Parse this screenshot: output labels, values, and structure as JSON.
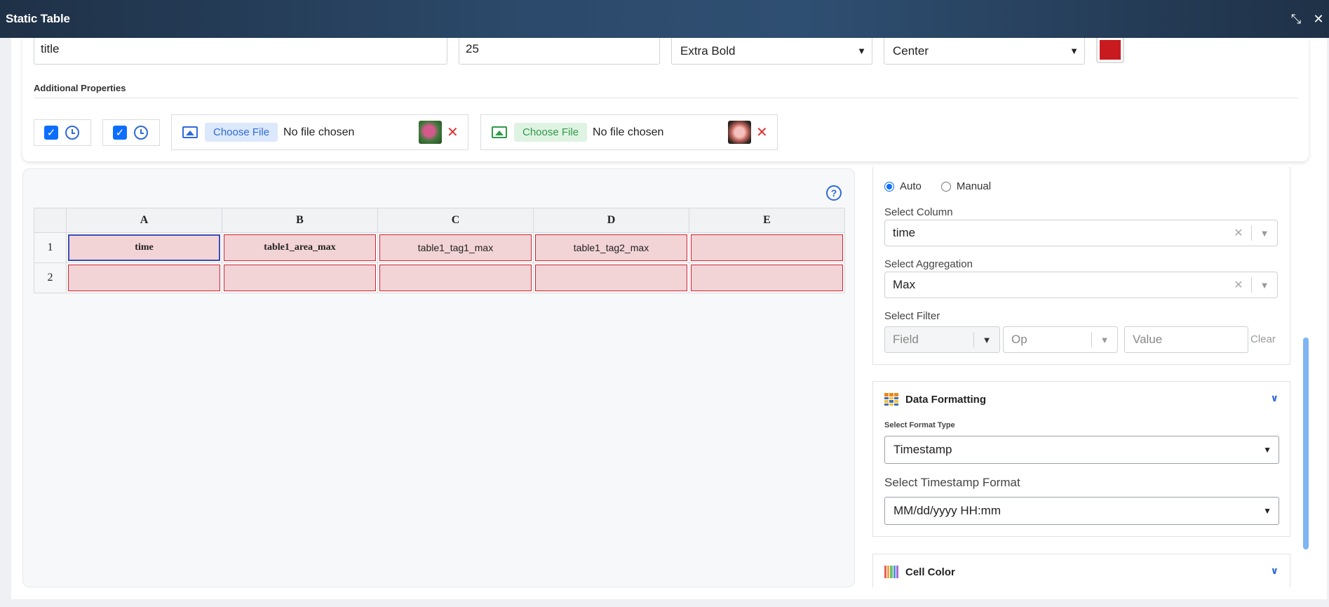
{
  "window": {
    "title": "Static Table",
    "restore_icon": "compress-icon",
    "close_icon": "close-icon"
  },
  "title_props": {
    "text_value": "title",
    "font_size": "25",
    "font_weight": "Extra Bold",
    "alignment": "Center",
    "color": "#c91a1f"
  },
  "additional": {
    "label": "Additional Properties",
    "file1": {
      "button": "Choose File",
      "status": "No file chosen",
      "accent": "#2f6ad9"
    },
    "file2": {
      "button": "Choose File",
      "status": "No file chosen",
      "accent": "#2f9a48"
    },
    "remove": "✕"
  },
  "grid": {
    "help": "?",
    "columns": [
      "A",
      "B",
      "C",
      "D",
      "E"
    ],
    "rows": [
      {
        "num": "1",
        "cells": [
          "time",
          "table1_area_max",
          "table1_tag1_max",
          "table1_tag2_max",
          ""
        ]
      },
      {
        "num": "2",
        "cells": [
          "",
          "",
          "",
          "",
          ""
        ]
      }
    ]
  },
  "config": {
    "mode_auto": "Auto",
    "mode_manual": "Manual",
    "column_label": "Select Column",
    "column_value": "time",
    "aggregation_label": "Select Aggregation",
    "aggregation_value": "Max",
    "filter_label": "Select Filter",
    "filter_field_ph": "Field",
    "filter_op_ph": "Op",
    "filter_value_ph": "Value",
    "filter_clear": "Clear",
    "clear_x": "✕",
    "chevron": "⌄"
  },
  "data_formatting": {
    "title": "Data Formatting",
    "format_type_label": "Select Format Type",
    "format_type_value": "Timestamp",
    "timestamp_label": "Select Timestamp Format",
    "timestamp_value": "MM/dd/yyyy HH:mm"
  },
  "cell_color": {
    "title": "Cell Color"
  }
}
